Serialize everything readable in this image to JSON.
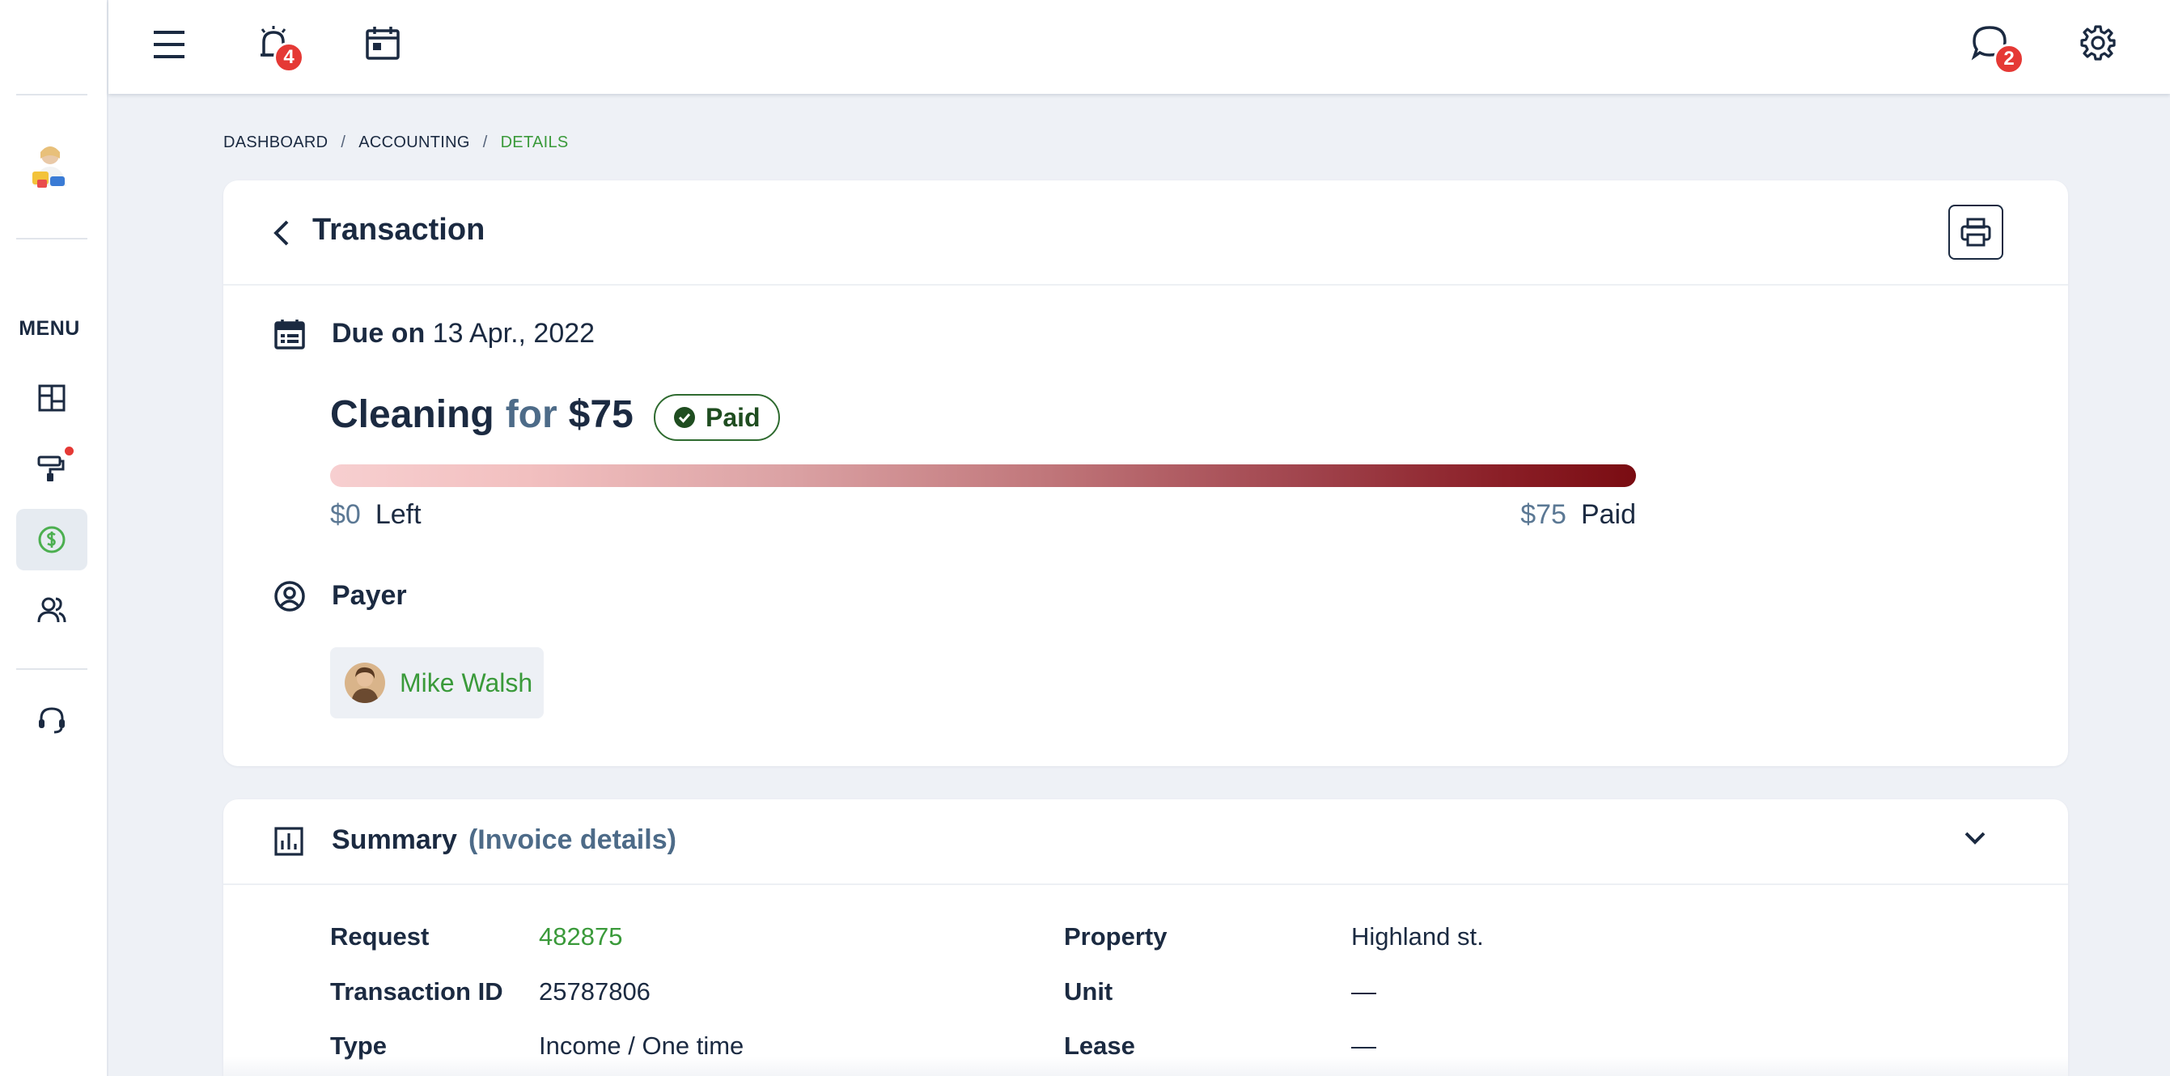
{
  "topbar": {
    "notifications_count": "4",
    "messages_count": "2"
  },
  "sidebar": {
    "menu_label": "MENU",
    "items": [
      {
        "name": "dashboard"
      },
      {
        "name": "maintenance",
        "has_dot": true
      },
      {
        "name": "accounting",
        "active": true
      },
      {
        "name": "people"
      },
      {
        "name": "support"
      }
    ]
  },
  "breadcrumb": {
    "items": [
      "DASHBOARD",
      "ACCOUNTING",
      "DETAILS"
    ],
    "separator": "/"
  },
  "transaction": {
    "title": "Transaction",
    "due_prefix": "Due on",
    "due_date": "13 Apr., 2022",
    "charge_name": "Cleaning",
    "charge_for": "for",
    "charge_amount": "$75",
    "status": "Paid",
    "progress": {
      "left_amount": "$0",
      "left_label": "Left",
      "paid_amount": "$75",
      "paid_label": "Paid",
      "paid_fraction": 1.0
    },
    "payer_label": "Payer",
    "payer_name": "Mike Walsh"
  },
  "summary": {
    "title": "Summary",
    "subtitle": "(Invoice details)",
    "left": [
      {
        "key": "Request",
        "value": "482875",
        "link": true
      },
      {
        "key": "Transaction ID",
        "value": "25787806"
      },
      {
        "key": "Type",
        "value": "Income / One time"
      }
    ],
    "right": [
      {
        "key": "Property",
        "value": "Highland st."
      },
      {
        "key": "Unit",
        "value": "—"
      },
      {
        "key": "Lease",
        "value": "—"
      }
    ]
  },
  "colors": {
    "accent_green": "#3a9a3a",
    "badge_red": "#e53935",
    "text_dark": "#1b2a41",
    "muted_blue": "#4d6b88"
  }
}
